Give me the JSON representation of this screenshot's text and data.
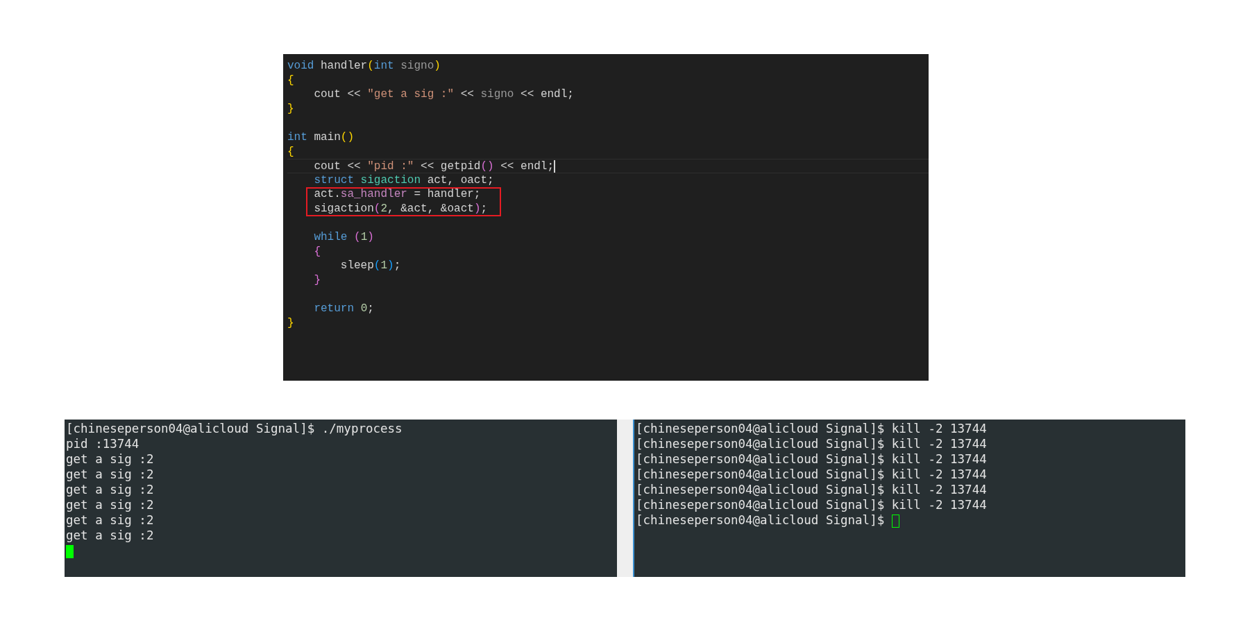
{
  "code_editor": {
    "lines": [
      {
        "tokens": [
          {
            "t": "void",
            "kind": "keyword"
          },
          {
            "t": " handler",
            "kind": "plain"
          },
          {
            "t": "(",
            "kind": "brace1"
          },
          {
            "t": "int",
            "kind": "keyword"
          },
          {
            "t": " signo",
            "kind": "param"
          },
          {
            "t": ")",
            "kind": "brace1"
          }
        ],
        "highlighted": false,
        "current": false
      },
      {
        "tokens": [
          {
            "t": "{",
            "kind": "brace1"
          }
        ],
        "highlighted": false,
        "current": false
      },
      {
        "tokens": [
          {
            "t": "    cout << ",
            "kind": "plain"
          },
          {
            "t": "\"get a sig :\"",
            "kind": "string"
          },
          {
            "t": " << ",
            "kind": "plain"
          },
          {
            "t": "signo",
            "kind": "param"
          },
          {
            "t": " << endl;",
            "kind": "plain"
          }
        ],
        "highlighted": false,
        "current": false
      },
      {
        "tokens": [
          {
            "t": "}",
            "kind": "brace1"
          }
        ],
        "highlighted": false,
        "current": false
      },
      {
        "highlighted": false,
        "current": false
      },
      {
        "tokens": [
          {
            "t": "int",
            "kind": "keyword"
          },
          {
            "t": " main",
            "kind": "plain"
          },
          {
            "t": "()",
            "kind": "brace1"
          }
        ],
        "highlighted": false,
        "current": false
      },
      {
        "tokens": [
          {
            "t": "{",
            "kind": "brace1"
          }
        ],
        "highlighted": false,
        "current": false
      },
      {
        "tokens": [
          {
            "t": "    cout << ",
            "kind": "plain"
          },
          {
            "t": "\"pid :\"",
            "kind": "string"
          },
          {
            "t": " << getpid",
            "kind": "plain"
          },
          {
            "t": "()",
            "kind": "brace2"
          },
          {
            "t": " << endl;",
            "kind": "plain"
          }
        ],
        "highlighted": false,
        "current": true
      },
      {
        "tokens": [
          {
            "t": "    struct",
            "kind": "keyword"
          },
          {
            "t": " sigaction",
            "kind": "type"
          },
          {
            "t": " act, oact;",
            "kind": "plain"
          }
        ],
        "highlighted": false,
        "current": false
      },
      {
        "tokens": [
          {
            "t": "    act.",
            "kind": "plain"
          },
          {
            "t": "sa_handler",
            "kind": "member"
          },
          {
            "t": " = handler;",
            "kind": "plain"
          }
        ],
        "highlighted": true,
        "current": false
      },
      {
        "tokens": [
          {
            "t": "    sigaction",
            "kind": "plain"
          },
          {
            "t": "(",
            "kind": "brace2"
          },
          {
            "t": "2",
            "kind": "number"
          },
          {
            "t": ", &act, &oact",
            "kind": "plain"
          },
          {
            "t": ")",
            "kind": "brace2"
          },
          {
            "t": ";",
            "kind": "plain"
          }
        ],
        "highlighted": true,
        "current": false
      },
      {
        "highlighted": false,
        "current": false
      },
      {
        "tokens": [
          {
            "t": "    while ",
            "kind": "keyword"
          },
          {
            "t": "(",
            "kind": "brace2"
          },
          {
            "t": "1",
            "kind": "number"
          },
          {
            "t": ")",
            "kind": "brace2"
          }
        ],
        "highlighted": false,
        "current": false
      },
      {
        "tokens": [
          {
            "t": "    {",
            "kind": "brace2"
          }
        ],
        "highlighted": false,
        "current": false
      },
      {
        "tokens": [
          {
            "t": "        sleep",
            "kind": "plain"
          },
          {
            "t": "(",
            "kind": "brace3"
          },
          {
            "t": "1",
            "kind": "number"
          },
          {
            "t": ")",
            "kind": "brace3"
          },
          {
            "t": ";",
            "kind": "plain"
          }
        ],
        "highlighted": false,
        "current": false
      },
      {
        "tokens": [
          {
            "t": "    }",
            "kind": "brace2"
          }
        ],
        "highlighted": false,
        "current": false
      },
      {
        "highlighted": false,
        "current": false
      },
      {
        "tokens": [
          {
            "t": "    return ",
            "kind": "keyword"
          },
          {
            "t": "0",
            "kind": "number"
          },
          {
            "t": ";",
            "kind": "plain"
          }
        ],
        "highlighted": false,
        "current": false
      },
      {
        "tokens": [
          {
            "t": "}",
            "kind": "brace1"
          }
        ],
        "highlighted": false,
        "current": false
      }
    ]
  },
  "terminals": [
    {
      "lines": [
        "[chineseperson04@alicloud Signal]$ ./myprocess",
        "pid :13744",
        "get a sig :2",
        "get a sig :2",
        "get a sig :2",
        "get a sig :2",
        "get a sig :2",
        "get a sig :2"
      ],
      "cursor": {
        "kind": "filled"
      }
    },
    {
      "lines": [
        "[chineseperson04@alicloud Signal]$ kill -2 13744",
        "[chineseperson04@alicloud Signal]$ kill -2 13744",
        "[chineseperson04@alicloud Signal]$ kill -2 13744",
        "[chineseperson04@alicloud Signal]$ kill -2 13744",
        "[chineseperson04@alicloud Signal]$ kill -2 13744",
        "[chineseperson04@alicloud Signal]$ kill -2 13744",
        "[chineseperson04@alicloud Signal]$ "
      ],
      "cursor": {
        "kind": "outline"
      }
    }
  ]
}
